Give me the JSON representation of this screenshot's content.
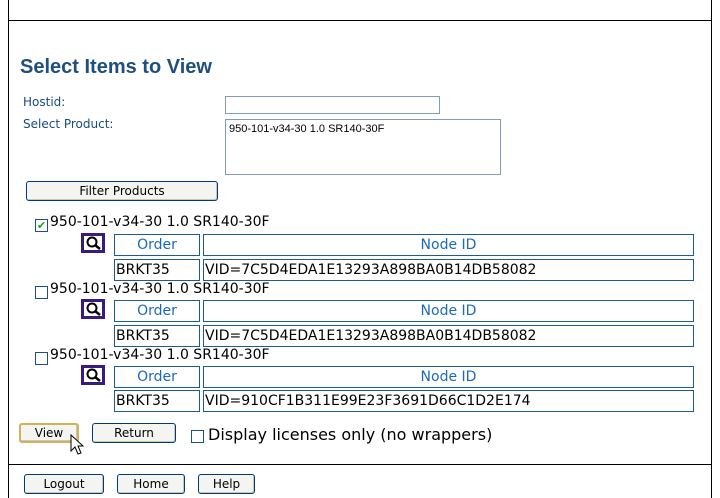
{
  "header": {
    "title": "Select Items to View"
  },
  "filters": {
    "hostid_label": "Hostid:",
    "hostid_value": "",
    "product_label": "Select Product:",
    "product_selected": "950-101-v34-30 1.0 SR140-30F",
    "filter_button": "Filter Products"
  },
  "columns": {
    "order": "Order",
    "node_id": "Node ID"
  },
  "products": [
    {
      "label": "950-101-v34-30 1.0 SR140-30F",
      "checked": true,
      "order": "BRKT35",
      "node_id": "VID=7C5D4EDA1E13293A898BA0B14DB58082"
    },
    {
      "label": "950-101-v34-30 1.0 SR140-30F",
      "checked": false,
      "order": "BRKT35",
      "node_id": "VID=7C5D4EDA1E13293A898BA0B14DB58082"
    },
    {
      "label": "950-101-v34-30 1.0 SR140-30F",
      "checked": false,
      "order": "BRKT35",
      "node_id": "VID=910CF1B311E99E23F3691D66C1D2E174"
    }
  ],
  "actions": {
    "view": "View",
    "return": "Return",
    "display_licenses_only": "Display licenses only (no wrappers)",
    "display_licenses_only_checked": false
  },
  "footer": {
    "logout": "Logout",
    "home": "Home",
    "help": "Help"
  },
  "colors": {
    "title": "#1f4f7f",
    "label": "#1a4a80",
    "table_border": "#1b5e8e",
    "header_text": "#1b6ab8",
    "icon_border": "#3a1a80"
  },
  "icons": {
    "details": "magnifier-icon",
    "checked": "checkmark-icon"
  }
}
